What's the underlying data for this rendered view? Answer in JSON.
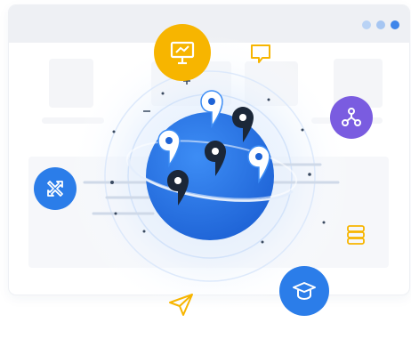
{
  "colors": {
    "globe_dark": "#1e63d6",
    "globe_light": "#3d8df5",
    "accent_yellow": "#f7b500",
    "accent_purple": "#7a5ce0",
    "accent_blue": "#2b7de9",
    "pin_dark": "#1b2738",
    "pin_white": "#ffffff",
    "window_bar": "#eef0f4",
    "window_dots": [
      "#b9d3f5",
      "#a6c6f2",
      "#3f86ea"
    ]
  },
  "icons": {
    "top_badge": "presentation-chart-icon",
    "right_badge": "network-nodes-icon",
    "left_badge": "tools-icon",
    "bottom_badge": "graduation-cap-icon",
    "chat": "chat-bubble-icon",
    "database": "database-icon",
    "send": "paper-plane-icon"
  }
}
